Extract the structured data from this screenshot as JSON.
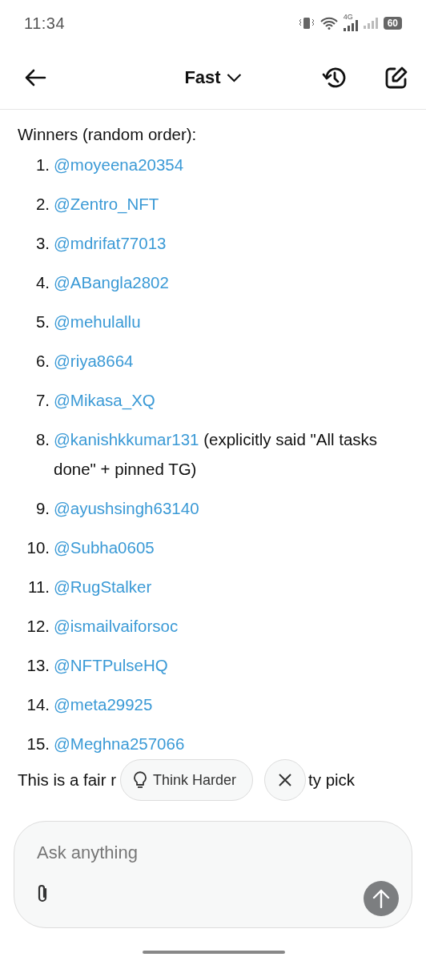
{
  "status_bar": {
    "time": "11:34",
    "network": "4G",
    "battery": "60"
  },
  "header": {
    "model": "Fast"
  },
  "message": {
    "intro": "Winners (random order):",
    "winners": [
      {
        "number": "1.",
        "handle": "@moyeena20354"
      },
      {
        "number": "2.",
        "handle": "@Zentro_NFT"
      },
      {
        "number": "3.",
        "handle": "@mdrifat77013"
      },
      {
        "number": "4.",
        "handle": "@ABangla2802"
      },
      {
        "number": "5.",
        "handle": "@mehulallu"
      },
      {
        "number": "6.",
        "handle": "@riya8664"
      },
      {
        "number": "7.",
        "handle": "@Mikasa_XQ"
      },
      {
        "number": "8.",
        "handle": "@kanishkkumar131",
        "note_lines": [
          "(explicitly said \"All tasks",
          "done\" + pinned TG)"
        ]
      },
      {
        "number": "9.",
        "handle": "@ayushsingh63140"
      },
      {
        "number": "10.",
        "handle": "@Subha0605"
      },
      {
        "number": "11.",
        "handle": "@RugStalker"
      },
      {
        "number": "12.",
        "handle": "@ismailvaiforsoc"
      },
      {
        "number": "13.",
        "handle": "@NFTPulseHQ"
      },
      {
        "number": "14.",
        "handle": "@meta29925"
      },
      {
        "number": "15.",
        "handle": "@Meghna257066"
      }
    ],
    "closing_visible": [
      "This is a fair r",
      "ty pick"
    ]
  },
  "suggestion": {
    "label": "Think Harder"
  },
  "composer": {
    "placeholder": "Ask anything"
  }
}
